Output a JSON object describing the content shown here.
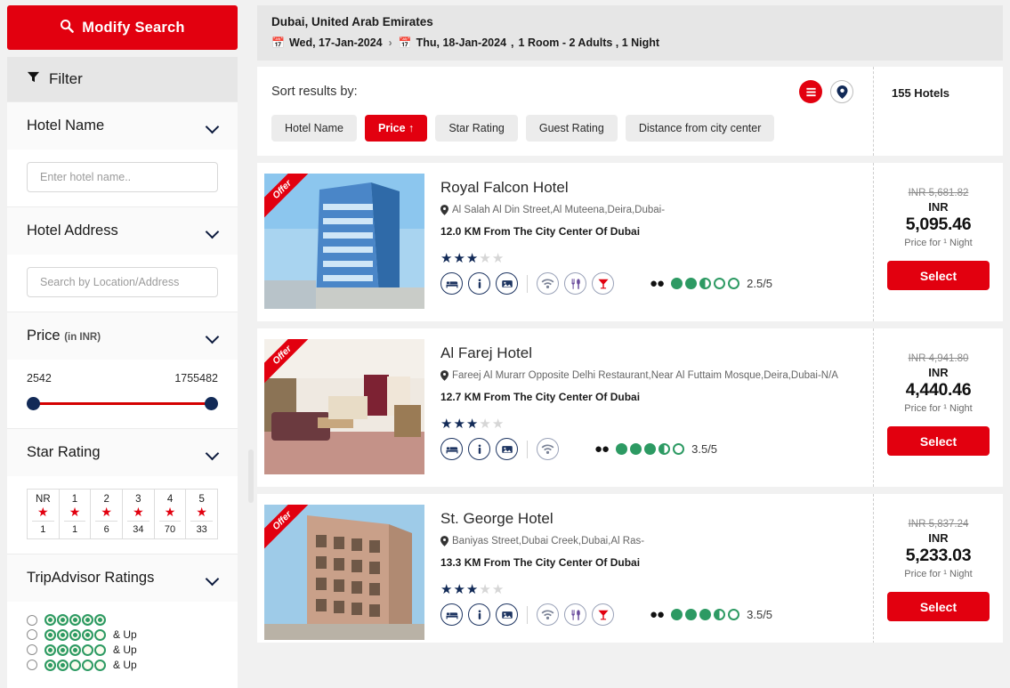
{
  "sidebar": {
    "modify_search": {
      "label": "Modify Search",
      "icon": "search-icon"
    },
    "filter_header": {
      "label": "Filter",
      "icon": "funnel-icon"
    },
    "hotel_name": {
      "title": "Hotel Name",
      "placeholder": "Enter hotel name.."
    },
    "hotel_address": {
      "title": "Hotel Address",
      "placeholder": "Search by Location/Address"
    },
    "price": {
      "title": "Price",
      "currency_note": "(in INR)",
      "min": "2542",
      "max": "1755482"
    },
    "star_rating": {
      "title": "Star Rating",
      "columns": [
        {
          "label": "NR",
          "count": "1"
        },
        {
          "label": "1",
          "count": "1"
        },
        {
          "label": "2",
          "count": "6"
        },
        {
          "label": "3",
          "count": "34"
        },
        {
          "label": "4",
          "count": "70"
        },
        {
          "label": "5",
          "count": "33"
        }
      ]
    },
    "tripadvisor": {
      "title": "TripAdvisor Ratings",
      "options": [
        {
          "filled": 5,
          "suffix": ""
        },
        {
          "filled": 4,
          "suffix": "& Up"
        },
        {
          "filled": 3,
          "suffix": "& Up"
        },
        {
          "filled": 2,
          "suffix": "& Up"
        }
      ]
    }
  },
  "breadcrumb": {
    "city": "Dubai, United Arab Emirates",
    "check_in": "Wed, 17-Jan-2024",
    "check_out": "Thu, 18-Jan-2024",
    "occupancy": "1 Room - 2 Adults , 1 Night",
    "separator": "›"
  },
  "sort": {
    "title": "Sort results by:",
    "chips": [
      {
        "label": "Hotel Name",
        "active": false
      },
      {
        "label": "Price ↑",
        "active": true
      },
      {
        "label": "Star Rating",
        "active": false
      },
      {
        "label": "Guest Rating",
        "active": false
      },
      {
        "label": "Distance from city center",
        "active": false
      }
    ],
    "view_list_icon": "list-view-icon",
    "view_map_icon": "map-pin-icon",
    "hotel_count": "155 Hotels"
  },
  "labels": {
    "offer_ribbon": "Offer",
    "select": "Select",
    "currency": "INR",
    "per_night": "Price for ¹ Night"
  },
  "hotels": [
    {
      "name": "Royal Falcon Hotel",
      "address": "Al Salah Al Din Street,Al Muteena,Deira,Dubai-",
      "distance": "12.0 KM From The City Center Of Dubai",
      "stars": 3,
      "amenities": [
        "wifi-icon",
        "restaurant-icon",
        "bar-icon"
      ],
      "ta_score": "2.5/5",
      "ta_filled": 2,
      "ta_half": true,
      "old_price": "INR 5,681.82",
      "price": "5,095.46",
      "image": "hotel-exterior-blue-tower"
    },
    {
      "name": "Al Farej Hotel",
      "address": "Fareej Al Murarr Opposite Delhi Restaurant,Near Al Futtaim Mosque,Deira,Dubai-N/A",
      "distance": "12.7 KM From The City Center Of Dubai",
      "stars": 3,
      "amenities": [
        "wifi-icon"
      ],
      "ta_score": "3.5/5",
      "ta_filled": 3,
      "ta_half": true,
      "old_price": "INR 4,941.80",
      "price": "4,440.46",
      "image": "hotel-room-interior"
    },
    {
      "name": "St. George Hotel",
      "address": "Baniyas Street,Dubai Creek,Dubai,Al Ras-",
      "distance": "13.3 KM From The City Center Of Dubai",
      "stars": 3,
      "amenities": [
        "wifi-icon",
        "restaurant-icon",
        "bar-icon"
      ],
      "ta_score": "3.5/5",
      "ta_filled": 3,
      "ta_half": true,
      "old_price": "INR 5,837.24",
      "price": "5,233.03",
      "image": "hotel-exterior-tan-tower"
    }
  ],
  "colors": {
    "brand_red": "#e2000f",
    "navy": "#122a57",
    "green": "#2d9a63",
    "purple": "#6a4b9c"
  }
}
